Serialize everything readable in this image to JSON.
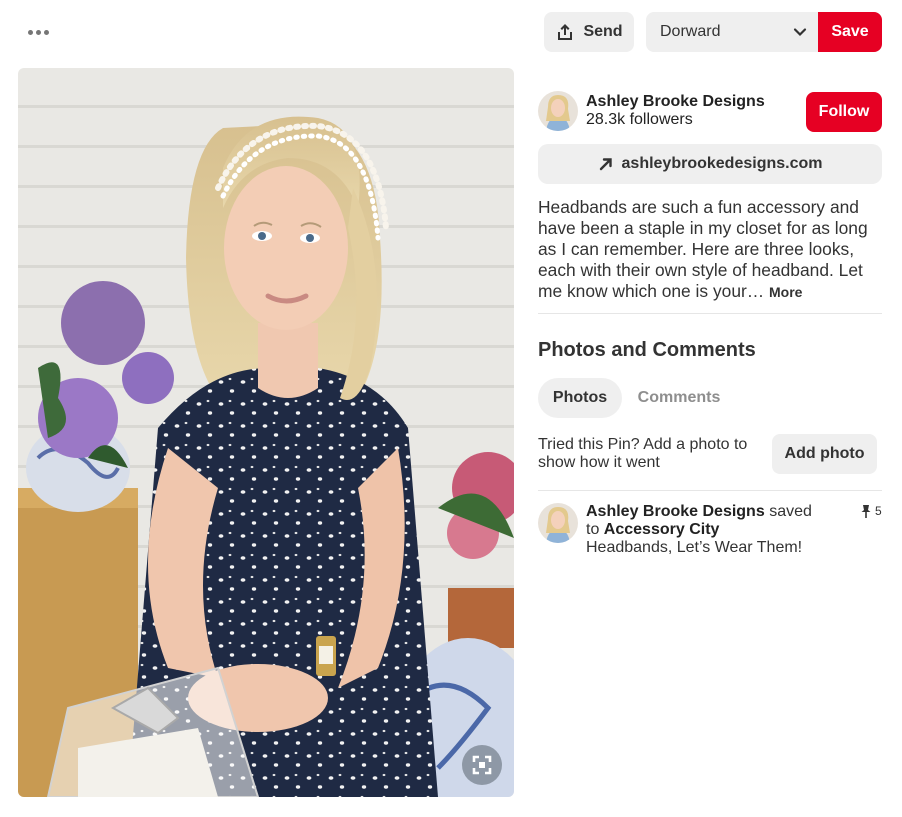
{
  "toolbar": {
    "more_icon": "more-dots-icon",
    "send_label": "Send",
    "board_selected": "Dorward",
    "save_label": "Save"
  },
  "creator": {
    "name": "Ashley Brooke Designs",
    "followers": "28.3k followers",
    "follow_label": "Follow"
  },
  "link": {
    "text": "ashleybrookedesigns.com"
  },
  "description": {
    "text": "Headbands are such a fun accessory and have been a staple in my closet for as long as I can remember. Here are three looks, each with their own style of headband. Let me know which one is your…",
    "more_label": "More"
  },
  "photos_comments": {
    "title": "Photos and Comments",
    "tabs": [
      {
        "label": "Photos",
        "active": true
      },
      {
        "label": "Comments",
        "active": false
      }
    ],
    "tried_text": "Tried this Pin? Add a photo to show how it went",
    "add_photo_label": "Add photo"
  },
  "activity": {
    "user": "Ashley Brooke Designs",
    "action": "saved",
    "to": "to",
    "board": "Accessory City",
    "title": "Headbands, Let’s Wear Them!",
    "pin_count": "5"
  },
  "colors": {
    "brand_red": "#e60023",
    "button_gray": "#efefef"
  }
}
